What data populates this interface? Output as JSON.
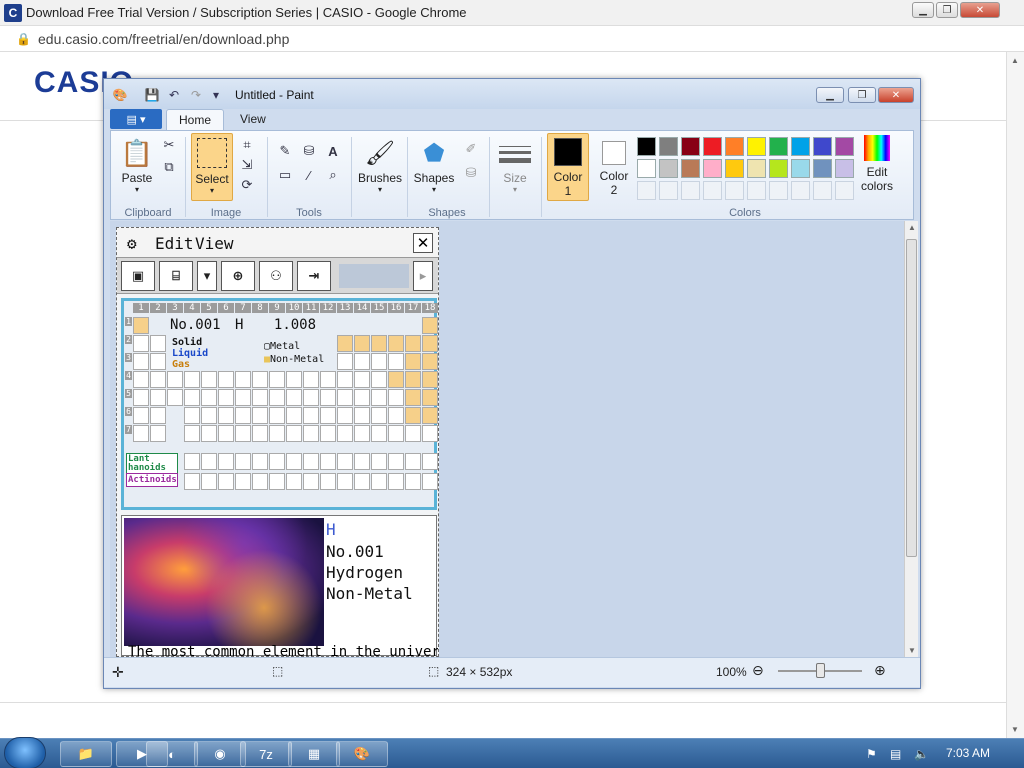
{
  "chrome": {
    "title": "Download Free Trial Version / Subscription Series | CASIO - Google Chrome",
    "url": "edu.casio.com/freetrial/en/download.php",
    "logo": "C"
  },
  "page": {
    "brand": "CASIO"
  },
  "paint": {
    "title": "Untitled - Paint",
    "file_tab_icon": "file-menu-icon",
    "tabs": [
      "Home",
      "View"
    ],
    "clipboard": {
      "paste": "Paste",
      "label": "Clipboard"
    },
    "image": {
      "select": "Select",
      "label": "Image"
    },
    "tools": {
      "label": "Tools"
    },
    "brushes": "Brushes",
    "shapes": {
      "button": "Shapes",
      "label": "Shapes"
    },
    "size": "Size",
    "color1": {
      "line1": "Color",
      "line2": "1",
      "value": "#000000"
    },
    "color2": {
      "line1": "Color",
      "line2": "2",
      "value": "#ffffff"
    },
    "edit_colors": {
      "line1": "Edit",
      "line2": "colors"
    },
    "colors_label": "Colors",
    "palette_row1": [
      "#000000",
      "#7f7f7f",
      "#880015",
      "#ed1c24",
      "#ff7f27",
      "#fff200",
      "#22b14c",
      "#00a2e8",
      "#3f48cc",
      "#a349a4"
    ],
    "palette_row2": [
      "#ffffff",
      "#c3c3c3",
      "#b97a57",
      "#ffaec9",
      "#ffc90e",
      "#efe4b0",
      "#b5e61d",
      "#99d9ea",
      "#7092be",
      "#c8bfe7"
    ],
    "status": {
      "canvas_size": "324 × 532px",
      "zoom": "100%"
    }
  },
  "calc": {
    "menu": {
      "edit": "Edit",
      "view": "View"
    },
    "element": {
      "no": "No.001",
      "symbol": "H",
      "mass": "1.008"
    },
    "legend": {
      "solid": "Solid",
      "liquid": "Liquid",
      "gas": "Gas",
      "metal": "Metal",
      "nonmetal": "Non-Metal"
    },
    "lanthanoids": "Lant hanoids",
    "actinoids": "Actinoids",
    "groups": [
      "1",
      "2",
      "3",
      "4",
      "5",
      "6",
      "7",
      "8",
      "9",
      "10",
      "11",
      "12",
      "13",
      "14",
      "15",
      "16",
      "17",
      "18"
    ],
    "periods": [
      "1",
      "2",
      "3",
      "4",
      "5",
      "6",
      "7"
    ],
    "detail": {
      "symbol": "H",
      "number": "No.001",
      "name": "Hydrogen",
      "category": "Non-Metal",
      "desc": "The most common element in the universe."
    }
  },
  "taskbar": {
    "time": "7:03 AM"
  }
}
